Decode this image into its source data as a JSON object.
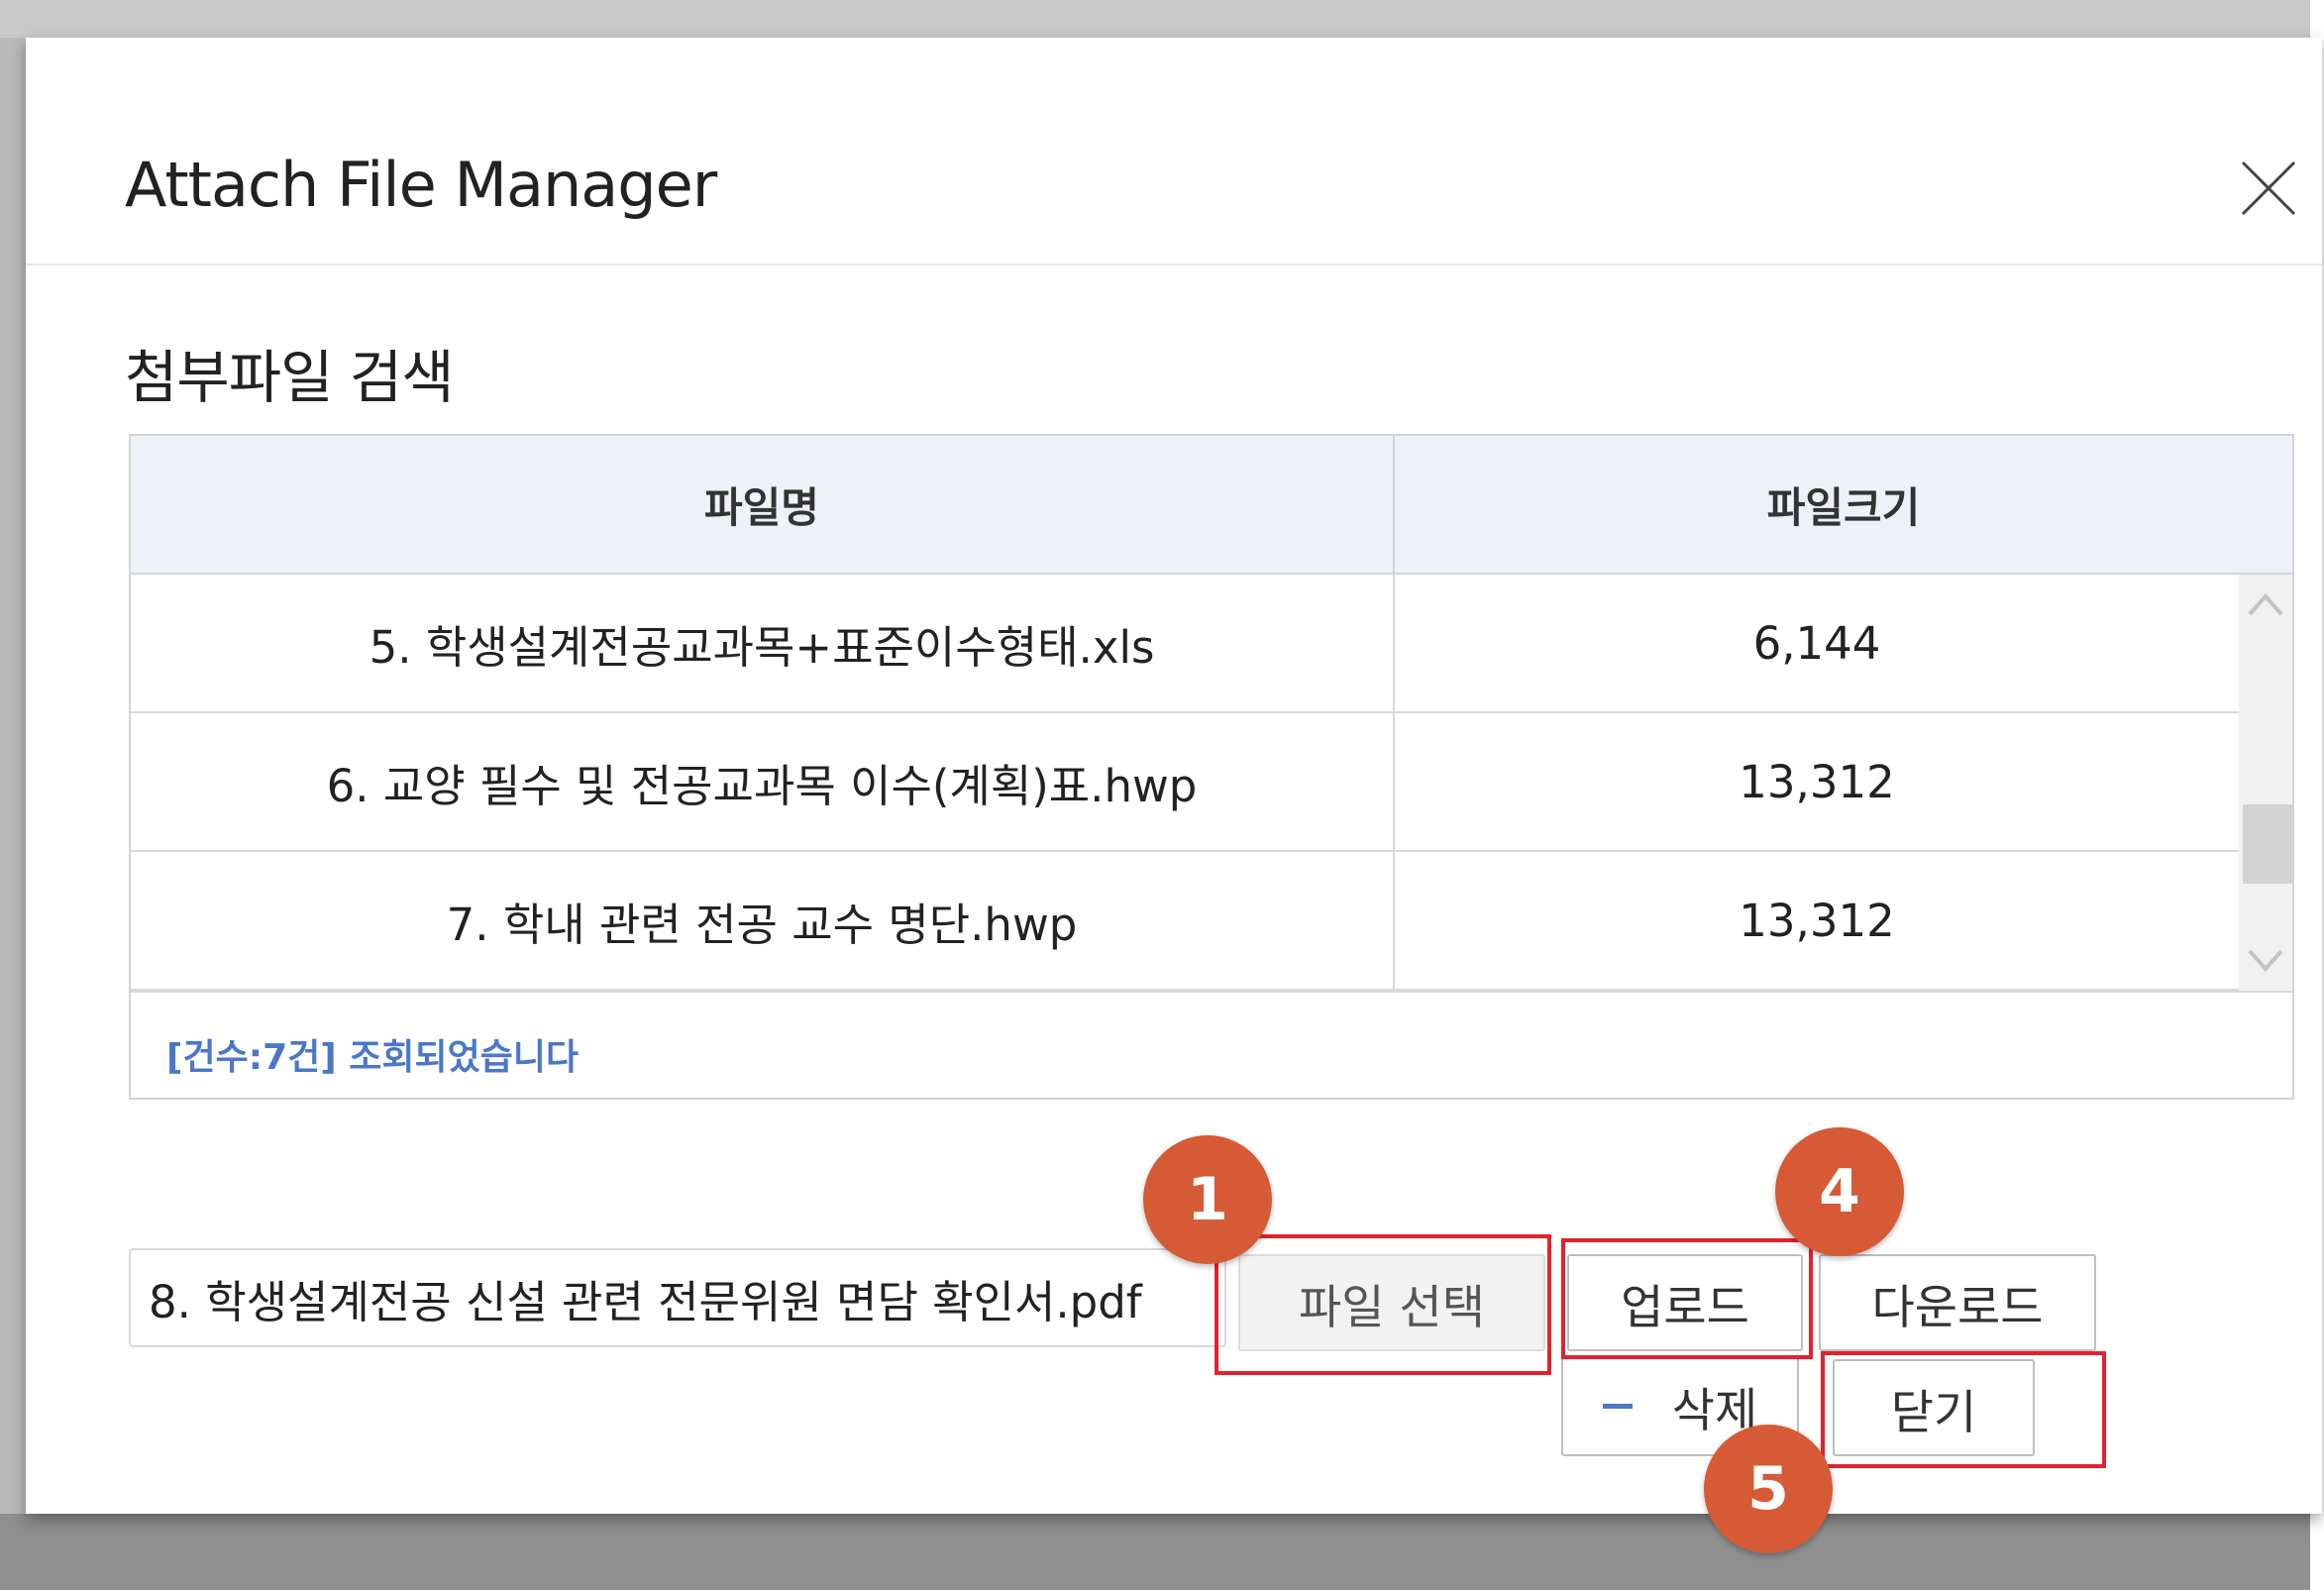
{
  "dialog": {
    "title": "Attach File Manager",
    "section_title": "첨부파일 검색"
  },
  "grid": {
    "columns": [
      "파일명",
      "파일크기"
    ],
    "rows": [
      {
        "name": "5. 학생설계전공교과목+표준이수형태.xls",
        "size": "6,144"
      },
      {
        "name": "6. 교양 필수 및 전공교과목 이수(계획)표.hwp",
        "size": "13,312"
      },
      {
        "name": "7. 학내 관련 전공 교수 명단.hwp",
        "size": "13,312"
      }
    ],
    "status": "[건수:7건] 조회되었습니다"
  },
  "upload": {
    "selected_file": "8. 학생설계전공 신설 관련 전문위원 면담 확인서.pdf",
    "select_label": "파일 선택",
    "upload_label": "업로드",
    "download_label": "다운로드",
    "delete_label": "삭제",
    "close_label": "닫기"
  },
  "annotations": {
    "badge_1": "1",
    "badge_4": "4",
    "badge_5": "5",
    "badge_color": "#d65a35",
    "highlight_color": "#e0232e"
  },
  "icons": {
    "close": "close-icon",
    "scroll_up": "chevron-up-icon",
    "scroll_down": "chevron-down-icon",
    "delete": "minus-icon"
  }
}
